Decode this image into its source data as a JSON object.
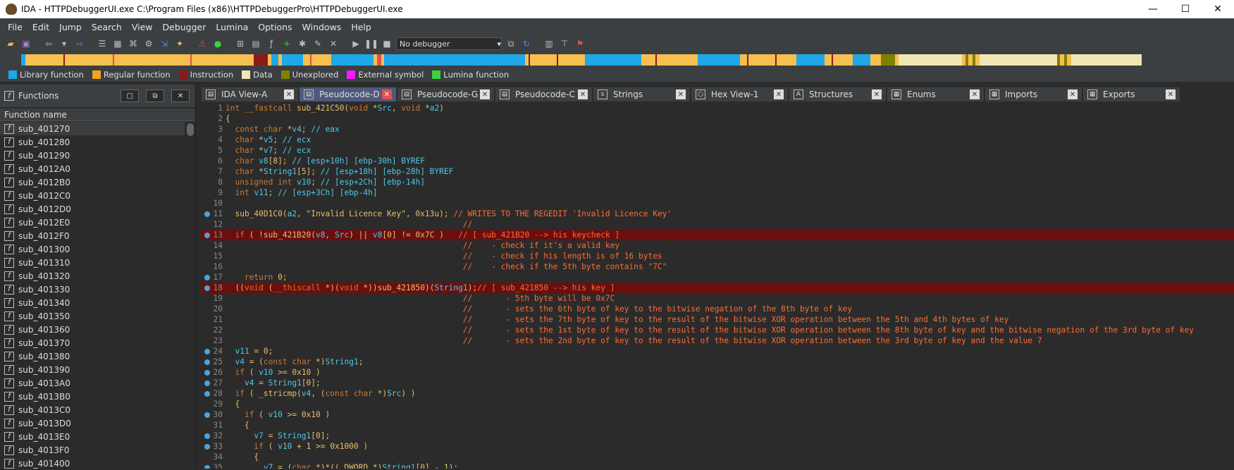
{
  "window": {
    "title": "IDA - HTTPDebuggerUI.exe C:\\Program Files (x86)\\HTTPDebuggerPro\\HTTPDebuggerUI.exe",
    "minimize": "—",
    "maximize": "☐",
    "close": "✕"
  },
  "menu": [
    "File",
    "Edit",
    "Jump",
    "Search",
    "View",
    "Debugger",
    "Lumina",
    "Options",
    "Windows",
    "Help"
  ],
  "toolbar": {
    "debugger_select": "No debugger"
  },
  "legend": [
    {
      "label": "Library function",
      "color": "#1fa7e8"
    },
    {
      "label": "Regular function",
      "color": "#f6a21b"
    },
    {
      "label": "Instruction",
      "color": "#8b1a1a"
    },
    {
      "label": "Data",
      "color": "#f0e6b4"
    },
    {
      "label": "Unexplored",
      "color": "#808000"
    },
    {
      "label": "External symbol",
      "color": "#ff1aff"
    },
    {
      "label": "Lumina function",
      "color": "#3bd13b"
    }
  ],
  "functions_panel": {
    "title": "Functions",
    "column": "Function name",
    "items": [
      "sub_401270",
      "sub_401280",
      "sub_401290",
      "sub_4012A0",
      "sub_4012B0",
      "sub_4012C0",
      "sub_4012D0",
      "sub_4012E0",
      "sub_4012F0",
      "sub_401300",
      "sub_401310",
      "sub_401320",
      "sub_401330",
      "sub_401340",
      "sub_401350",
      "sub_401360",
      "sub_401370",
      "sub_401380",
      "sub_401390",
      "sub_4013A0",
      "sub_4013B0",
      "sub_4013C0",
      "sub_4013D0",
      "sub_4013E0",
      "sub_4013F0",
      "sub_401400"
    ]
  },
  "tabs": [
    {
      "label": "IDA View-A",
      "active": false
    },
    {
      "label": "Pseudocode-D",
      "active": true
    },
    {
      "label": "Pseudocode-G",
      "active": false
    },
    {
      "label": "Pseudocode-C",
      "active": false
    },
    {
      "label": "Strings",
      "active": false
    },
    {
      "label": "Hex View-1",
      "active": false
    },
    {
      "label": "Structures",
      "active": false
    },
    {
      "label": "Enums",
      "active": false
    },
    {
      "label": "Imports",
      "active": false
    },
    {
      "label": "Exports",
      "active": false
    }
  ],
  "code_lines": [
    {
      "n": "1",
      "t": "int __fastcall sub_421C50(void *Src, void *a2)",
      "dot": false,
      "hl": false
    },
    {
      "n": "2",
      "t": "{",
      "dot": false,
      "hl": false
    },
    {
      "n": "3",
      "t": "  const char *v4; // eax",
      "dot": false,
      "hl": false
    },
    {
      "n": "4",
      "t": "  char *v5; // ecx",
      "dot": false,
      "hl": false
    },
    {
      "n": "5",
      "t": "  char *v7; // ecx",
      "dot": false,
      "hl": false
    },
    {
      "n": "6",
      "t": "  char v8[8]; // [esp+10h] [ebp-30h] BYREF",
      "dot": false,
      "hl": false
    },
    {
      "n": "7",
      "t": "  char *String1[5]; // [esp+18h] [ebp-28h] BYREF",
      "dot": false,
      "hl": false
    },
    {
      "n": "8",
      "t": "  unsigned int v10; // [esp+2Ch] [ebp-14h]",
      "dot": false,
      "hl": false
    },
    {
      "n": "9",
      "t": "  int v11; // [esp+3Ch] [ebp-4h]",
      "dot": false,
      "hl": false
    },
    {
      "n": "10",
      "t": "",
      "dot": false,
      "hl": false
    },
    {
      "n": "11",
      "t": "  sub_40D1C0(a2, \"Invalid Licence Key\", 0x13u); // WRITES TO THE REGEDIT 'Invalid Licence Key'",
      "dot": true,
      "hl": false
    },
    {
      "n": "12",
      "t": "                                                  //",
      "dot": false,
      "hl": false
    },
    {
      "n": "13",
      "t": "  if ( !sub_421B20(v8, Src) || v8[0] != 0x7C )   // [ sub_421B20 --> his keycheck ]",
      "dot": true,
      "hl": true
    },
    {
      "n": "14",
      "t": "                                                  //    - check if it's a valid key",
      "dot": false,
      "hl": false
    },
    {
      "n": "15",
      "t": "                                                  //    - check if his length is of 16 bytes",
      "dot": false,
      "hl": false
    },
    {
      "n": "16",
      "t": "                                                  //    - check if the 5th byte contains \"7C\"",
      "dot": false,
      "hl": false
    },
    {
      "n": "17",
      "t": "    return 0;",
      "dot": true,
      "hl": false
    },
    {
      "n": "18",
      "t": "  ((void (__thiscall *)(void *))sub_421850)(String1);// [ sub_421850 --> his key ]",
      "dot": true,
      "hl": true
    },
    {
      "n": "19",
      "t": "                                                  //       - 5th byte will be 0x7C",
      "dot": false,
      "hl": false
    },
    {
      "n": "20",
      "t": "                                                  //       - sets the 6th byte of key to the bitwise negation of the 8th byte of key",
      "dot": false,
      "hl": false
    },
    {
      "n": "21",
      "t": "                                                  //       - sets the 7th byte of key to the result of the bitwise XOR operation between the 5th and 4th bytes of key",
      "dot": false,
      "hl": false
    },
    {
      "n": "22",
      "t": "                                                  //       - sets the 1st byte of key to the result of the bitwise XOR operation between the 8th byte of key and the bitwise negation of the 3rd byte of key",
      "dot": false,
      "hl": false
    },
    {
      "n": "23",
      "t": "                                                  //       - sets the 2nd byte of key to the result of the bitwise XOR operation between the 3rd byte of key and the value 7",
      "dot": false,
      "hl": false
    },
    {
      "n": "24",
      "t": "  v11 = 0;",
      "dot": true,
      "hl": false
    },
    {
      "n": "25",
      "t": "  v4 = (const char *)String1;",
      "dot": true,
      "hl": false
    },
    {
      "n": "26",
      "t": "  if ( v10 >= 0x10 )",
      "dot": true,
      "hl": false
    },
    {
      "n": "27",
      "t": "    v4 = String1[0];",
      "dot": true,
      "hl": false
    },
    {
      "n": "28",
      "t": "  if ( _stricmp(v4, (const char *)Src) )",
      "dot": true,
      "hl": false
    },
    {
      "n": "29",
      "t": "  {",
      "dot": false,
      "hl": false
    },
    {
      "n": "30",
      "t": "    if ( v10 >= 0x10 )",
      "dot": true,
      "hl": false
    },
    {
      "n": "31",
      "t": "    {",
      "dot": false,
      "hl": false
    },
    {
      "n": "32",
      "t": "      v7 = String1[0];",
      "dot": true,
      "hl": false
    },
    {
      "n": "33",
      "t": "      if ( v10 + 1 >= 0x1000 )",
      "dot": true,
      "hl": false
    },
    {
      "n": "34",
      "t": "      {",
      "dot": false,
      "hl": false
    },
    {
      "n": "35",
      "t": "        v7 = (char *)*((_DWORD *)String1[0] - 1);",
      "dot": true,
      "hl": false
    }
  ]
}
